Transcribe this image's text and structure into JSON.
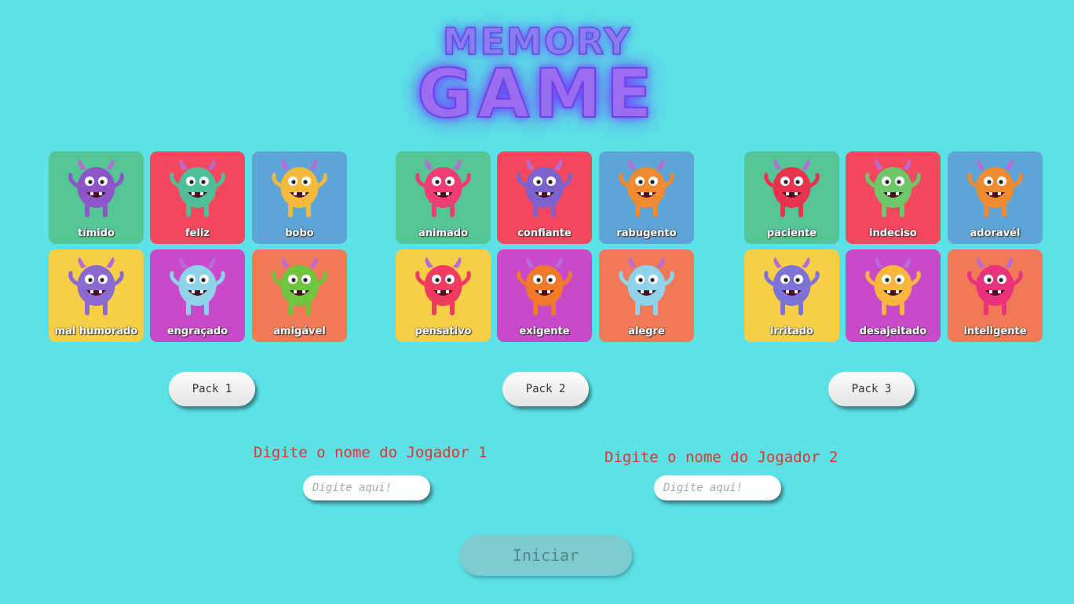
{
  "title": {
    "top": "MEMORY",
    "main": "GAME"
  },
  "packs": [
    {
      "label": "Pack 1",
      "cards": [
        {
          "label": "tímido",
          "bg": "#56c596",
          "monster": "#8e55c9"
        },
        {
          "label": "feliz",
          "bg": "#f4485e",
          "monster": "#4fbf99"
        },
        {
          "label": "bobo",
          "bg": "#5ea4d6",
          "monster": "#f5b93c"
        },
        {
          "label": "mal humorado",
          "bg": "#f7cf47",
          "monster": "#8a6ad1"
        },
        {
          "label": "engraçado",
          "bg": "#c94ac9",
          "monster": "#8ed3ea"
        },
        {
          "label": "amigável",
          "bg": "#f07a56",
          "monster": "#6ec63f"
        }
      ]
    },
    {
      "label": "Pack 2",
      "cards": [
        {
          "label": "animado",
          "bg": "#56c596",
          "monster": "#f03c74"
        },
        {
          "label": "confiante",
          "bg": "#f4485e",
          "monster": "#7b62cc"
        },
        {
          "label": "rabugento",
          "bg": "#5ea4d6",
          "monster": "#f08a30"
        },
        {
          "label": "pensativo",
          "bg": "#f7cf47",
          "monster": "#ee3b5f"
        },
        {
          "label": "exigente",
          "bg": "#c94ac9",
          "monster": "#f07a2a"
        },
        {
          "label": "alegre",
          "bg": "#f07a56",
          "monster": "#8ed3ea"
        }
      ]
    },
    {
      "label": "Pack 3",
      "cards": [
        {
          "label": "paciente",
          "bg": "#56c596",
          "monster": "#e8334f"
        },
        {
          "label": "indeciso",
          "bg": "#f4485e",
          "monster": "#6ec86a"
        },
        {
          "label": "adoravél",
          "bg": "#5ea4d6",
          "monster": "#f08a30"
        },
        {
          "label": "irritado",
          "bg": "#f7cf47",
          "monster": "#7d72d6"
        },
        {
          "label": "desajeitado",
          "bg": "#c94ac9",
          "monster": "#f7b73a"
        },
        {
          "label": "inteligente",
          "bg": "#f07a56",
          "monster": "#e8337c"
        }
      ]
    }
  ],
  "players": [
    {
      "prompt": "Digite o nome do Jogador 1",
      "placeholder": "Digite aqui!"
    },
    {
      "prompt": "Digite o nome do Jogador 2",
      "placeholder": "Digite aqui!"
    }
  ],
  "start_label": "Iniciar",
  "colors": {
    "background": "#5ce1e6",
    "title_glow": "#7b3cff",
    "prompt": "#e0342d"
  }
}
